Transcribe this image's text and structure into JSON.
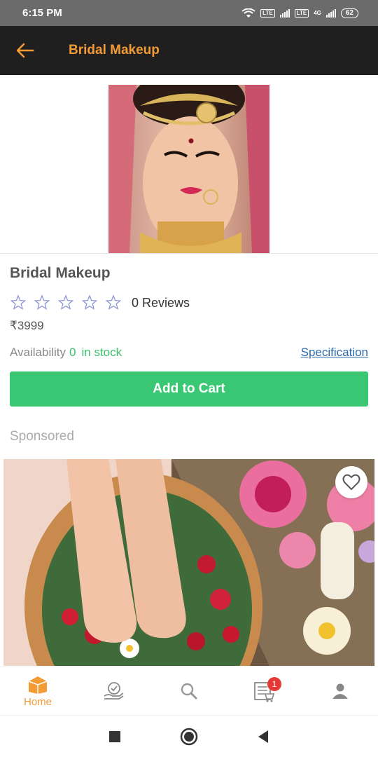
{
  "status_bar": {
    "time": "6:15 PM",
    "battery": "62",
    "lte1": "LTE",
    "lte2": "LTE",
    "net": "4G"
  },
  "app_bar": {
    "title": "Bridal Makeup",
    "back_icon": "arrow-left-icon"
  },
  "product": {
    "name": "Bridal Makeup",
    "rating": 0,
    "reviews_label": "0 Reviews",
    "price": "₹3999",
    "availability_label": "Availability",
    "availability_count": "0",
    "availability_status": "in stock",
    "specification_link": "Specification",
    "add_to_cart_label": "Add to Cart"
  },
  "sponsored": {
    "label": "Sponsored"
  },
  "bottom_nav": {
    "items": [
      {
        "label": "Home",
        "icon": "home-box-icon",
        "active": true
      },
      {
        "label": "",
        "icon": "service-hand-icon"
      },
      {
        "label": "",
        "icon": "search-icon"
      },
      {
        "label": "",
        "icon": "cart-list-icon",
        "badge": "1"
      },
      {
        "label": "",
        "icon": "profile-icon"
      }
    ]
  },
  "colors": {
    "accent": "#f39b34",
    "app_bar": "#1f1f1f",
    "green": "#39c774",
    "badge": "#e53935",
    "link": "#2e6aa8"
  }
}
